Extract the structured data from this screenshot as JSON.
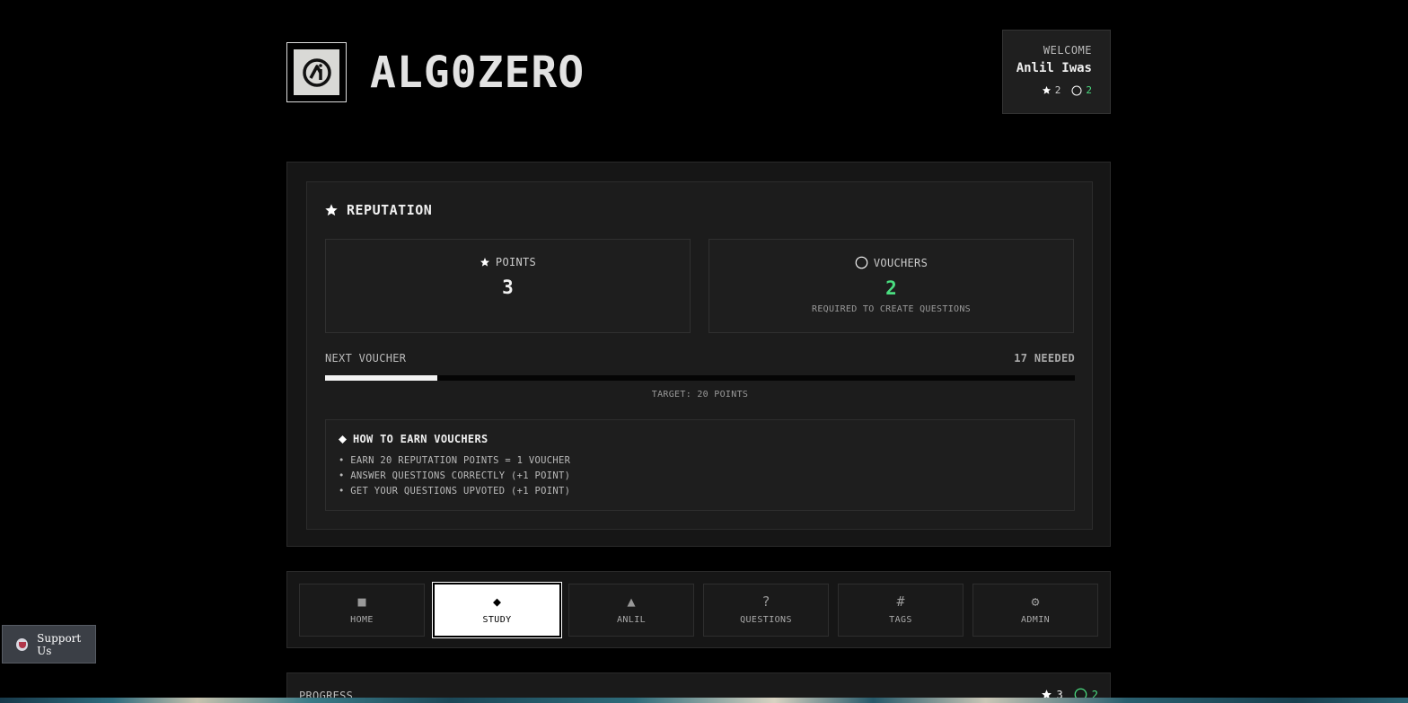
{
  "header": {
    "app_title": "ALG0ZERO",
    "welcome_label": "WELCOME",
    "user_name": "Anlil Iwas",
    "points": "2",
    "vouchers": "2"
  },
  "reputation": {
    "title": "REPUTATION",
    "points_label": "POINTS",
    "points_value": "3",
    "vouchers_label": "VOUCHERS",
    "vouchers_value": "2",
    "vouchers_sub": "REQUIRED TO CREATE QUESTIONS",
    "next_voucher_label": "NEXT VOUCHER",
    "needed_text": "17 NEEDED",
    "progress_fraction": 0.15,
    "target_text": "TARGET: 20 POINTS",
    "how_title": "HOW TO EARN VOUCHERS",
    "how_items": [
      "• EARN 20 REPUTATION POINTS = 1 VOUCHER",
      "• ANSWER QUESTIONS CORRECTLY (+1 POINT)",
      "• GET YOUR QUESTIONS UPVOTED (+1 POINT)"
    ]
  },
  "nav": {
    "items": [
      {
        "label": "HOME",
        "icon": "■"
      },
      {
        "label": "STUDY",
        "icon": "◆"
      },
      {
        "label": "ANLIL",
        "icon": "▲"
      },
      {
        "label": "QUESTIONS",
        "icon": "?"
      },
      {
        "label": "TAGS",
        "icon": "#"
      },
      {
        "label": "ADMIN",
        "icon": "⚙"
      }
    ],
    "active_label": "STUDY"
  },
  "progress_section": {
    "label": "PROGRESS",
    "points": "3",
    "vouchers": "2"
  },
  "support": {
    "label": "Support Us"
  },
  "colors": {
    "accent_green": "#4ade80",
    "background": "#000000",
    "panel": "#161616"
  }
}
